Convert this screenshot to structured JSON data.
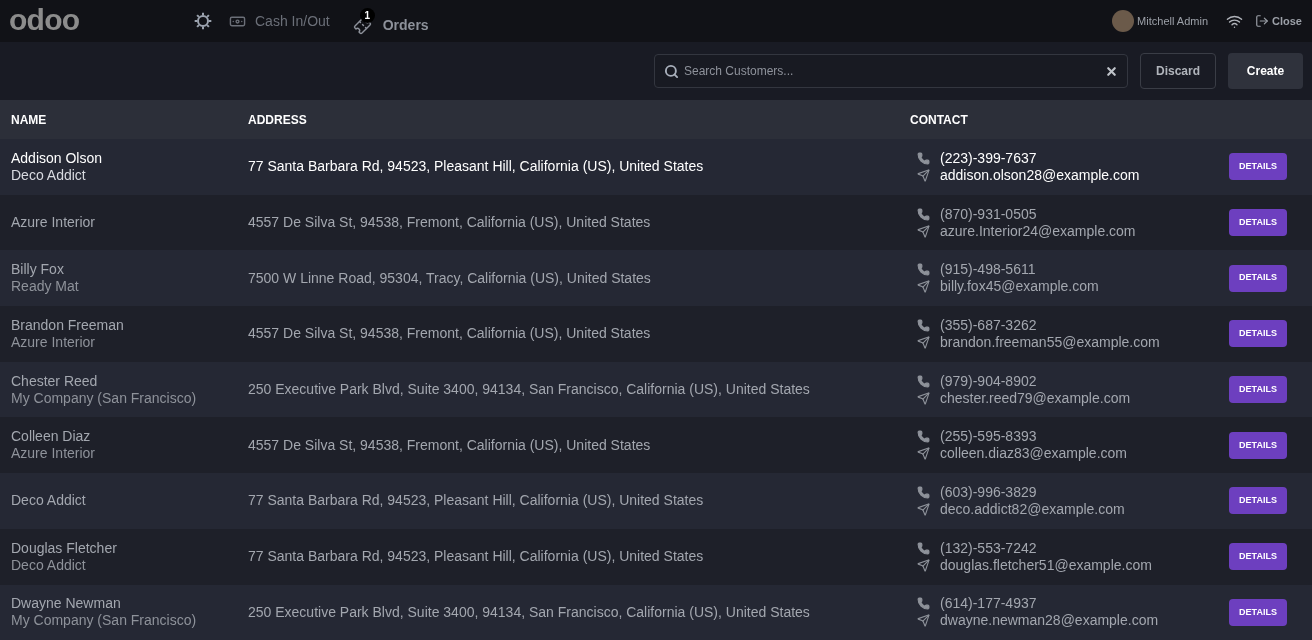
{
  "navbar": {
    "logo": "odoo",
    "cash_in_out": "Cash In/Out",
    "orders": {
      "label": "Orders",
      "badge": "1"
    },
    "user": "Mitchell Admin",
    "close": "Close"
  },
  "toolbar": {
    "search": {
      "placeholder": "Search Customers..."
    },
    "discard": "Discard",
    "create": "Create"
  },
  "table": {
    "columns": [
      "NAME",
      "ADDRESS",
      "CONTACT"
    ],
    "rows": [
      {
        "name": "Addison Olson",
        "company": "Deco Addict",
        "address": "77 Santa Barbara Rd, 94523, Pleasant Hill, California (US), United States",
        "phone": "(223)-399-7637",
        "email": "addison.olson28@example.com",
        "button": "DETAILS",
        "selected": true
      },
      {
        "name": "Azure Interior",
        "address": "4557 De Silva St, 94538, Fremont, California (US), United States",
        "phone": "(870)-931-0505",
        "email": "azure.Interior24@example.com",
        "button": "DETAILS",
        "selected": false
      },
      {
        "name": "Billy Fox",
        "company": "Ready Mat",
        "address": "7500 W Linne Road, 95304, Tracy, California (US), United States",
        "phone": "(915)-498-5611",
        "email": "billy.fox45@example.com",
        "button": "DETAILS",
        "selected": false
      },
      {
        "name": "Brandon Freeman",
        "company": "Azure Interior",
        "address": "4557 De Silva St, 94538, Fremont, California (US), United States",
        "phone": "(355)-687-3262",
        "email": "brandon.freeman55@example.com",
        "button": "DETAILS",
        "selected": false
      },
      {
        "name": "Chester Reed",
        "company": "My Company (San Francisco)",
        "address": "250 Executive Park Blvd, Suite 3400, 94134, San Francisco, California (US), United States",
        "phone": "(979)-904-8902",
        "email": "chester.reed79@example.com",
        "button": "DETAILS",
        "selected": false
      },
      {
        "name": "Colleen Diaz",
        "company": "Azure Interior",
        "address": "4557 De Silva St, 94538, Fremont, California (US), United States",
        "phone": "(255)-595-8393",
        "email": "colleen.diaz83@example.com",
        "button": "DETAILS",
        "selected": false
      },
      {
        "name": "Deco Addict",
        "address": "77 Santa Barbara Rd, 94523, Pleasant Hill, California (US), United States",
        "phone": "(603)-996-3829",
        "email": "deco.addict82@example.com",
        "button": "DETAILS",
        "selected": false
      },
      {
        "name": "Douglas Fletcher",
        "company": "Deco Addict",
        "address": "77 Santa Barbara Rd, 94523, Pleasant Hill, California (US), United States",
        "phone": "(132)-553-7242",
        "email": "douglas.fletcher51@example.com",
        "button": "DETAILS",
        "selected": false
      },
      {
        "name": "Dwayne Newman",
        "company": "My Company (San Francisco)",
        "address": "250 Executive Park Blvd, Suite 3400, 94134, San Francisco, California (US), United States",
        "phone": "(614)-177-4937",
        "email": "dwayne.newman28@example.com",
        "button": "DETAILS",
        "selected": false
      }
    ]
  }
}
